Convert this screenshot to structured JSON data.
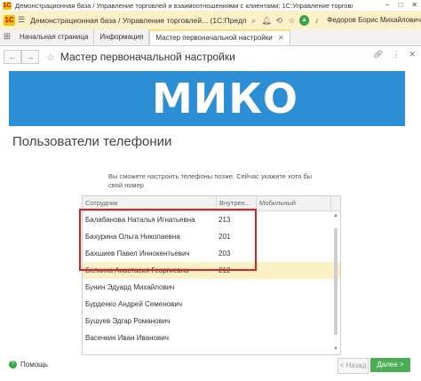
{
  "os": {
    "logo": "1С",
    "title": "Демонстрационная база / Управление торговлей и взаимоотношениями с клиентами: 1С:Управление торговлей (11....",
    "buttons": [
      "–",
      "□",
      "✕"
    ]
  },
  "header": {
    "logo": "1С",
    "title": "Демонстрационная база / Управление торговлей... (1С:Предприятие)",
    "user": "Федоров Борис Михайлович"
  },
  "tabs": {
    "items": [
      {
        "label": "Начальная страница"
      },
      {
        "label": "Информация"
      },
      {
        "label": "Мастер первоначальной настройки"
      }
    ]
  },
  "form": {
    "title": "Мастер первоначальной настройки"
  },
  "banner": {
    "logo_text": "МИКО",
    "color": "#2c8ed4"
  },
  "page": {
    "title": "Пользователи телефонии",
    "hint": "Вы сможете настроить телефоны позже. Сейчас укажите хотя бы свой номер"
  },
  "table": {
    "columns": [
      "Сотрудник",
      "Внутрен...",
      "Мобильный"
    ],
    "rows": [
      {
        "name": "Балабанова Наталья Игнатьевна",
        "ext": "213",
        "mobile": ""
      },
      {
        "name": "Бахурина Ольга Николаевна",
        "ext": "201",
        "mobile": ""
      },
      {
        "name": "Бахшиев Павел Иннокентьевич",
        "ext": "203",
        "mobile": ""
      },
      {
        "name": "Белкина Анастасия Георгиевна",
        "ext": "212",
        "mobile": ""
      },
      {
        "name": "Бунин Эдуард Михайлович",
        "ext": "",
        "mobile": ""
      },
      {
        "name": "Бурденко Андрей Семенович",
        "ext": "",
        "mobile": ""
      },
      {
        "name": "Бушуев Эдгар Романович",
        "ext": "",
        "mobile": ""
      },
      {
        "name": "Васечкин Иван Иванович",
        "ext": "",
        "mobile": ""
      }
    ],
    "selected_row": 3
  },
  "footer": {
    "help": "Помощь",
    "back": "< Назад",
    "next": "Далее >"
  },
  "colors": {
    "accent_header": "#fdf1c7",
    "highlight": "#d9241d",
    "next_button": "#4cae54"
  }
}
